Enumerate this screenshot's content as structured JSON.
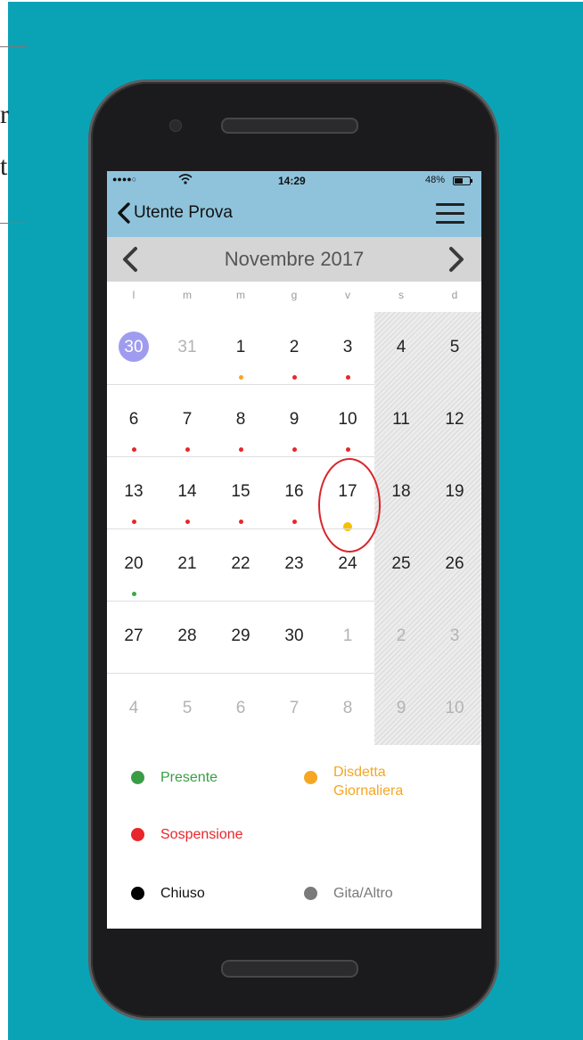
{
  "colors": {
    "background": "#0aa3b5",
    "header_bg": "#8fc3dc",
    "month_bar_bg": "#d5d5d5",
    "today_highlight": "#9f9cf0",
    "annotation_ring": "#d9252b"
  },
  "edge_fragments": [
    "r",
    "t"
  ],
  "status_bar": {
    "signal": "●●●●○",
    "wifi_icon": "wifi-icon",
    "time": "14:29",
    "battery": "48%",
    "battery_icon": "battery-icon"
  },
  "nav": {
    "back_icon": "chevron-left-icon",
    "title": "Utente Prova",
    "menu_icon": "hamburger-menu-icon"
  },
  "calendar": {
    "month_title": "Novembre 2017",
    "prev_icon": "chevron-left-icon",
    "next_icon": "chevron-right-icon",
    "weekdays": [
      "l",
      "m",
      "m",
      "g",
      "v",
      "s",
      "d"
    ],
    "weeks": [
      [
        {
          "day": "30",
          "dim": true,
          "today": true
        },
        {
          "day": "31",
          "dim": true
        },
        {
          "day": "1",
          "dot": "#f5a623"
        },
        {
          "day": "2",
          "dot": "#e8262b"
        },
        {
          "day": "3",
          "dot": "#e8262b"
        },
        {
          "day": "4"
        },
        {
          "day": "5"
        }
      ],
      [
        {
          "day": "6",
          "dot": "#e8262b"
        },
        {
          "day": "7",
          "dot": "#e8262b"
        },
        {
          "day": "8",
          "dot": "#e8262b"
        },
        {
          "day": "9",
          "dot": "#e8262b"
        },
        {
          "day": "10",
          "dot": "#e8262b"
        },
        {
          "day": "11"
        },
        {
          "day": "12"
        }
      ],
      [
        {
          "day": "13",
          "dot": "#e8262b"
        },
        {
          "day": "14",
          "dot": "#e8262b"
        },
        {
          "day": "15",
          "dot": "#e8262b"
        },
        {
          "day": "16",
          "dot": "#e8262b"
        },
        {
          "day": "17",
          "dot": "#f5c000",
          "big": true
        },
        {
          "day": "18"
        },
        {
          "day": "19"
        }
      ],
      [
        {
          "day": "20",
          "dot": "#3aa845"
        },
        {
          "day": "21"
        },
        {
          "day": "22"
        },
        {
          "day": "23"
        },
        {
          "day": "24"
        },
        {
          "day": "25"
        },
        {
          "day": "26"
        }
      ],
      [
        {
          "day": "27"
        },
        {
          "day": "28"
        },
        {
          "day": "29"
        },
        {
          "day": "30"
        },
        {
          "day": "1",
          "dim": true
        },
        {
          "day": "2",
          "dim": true
        },
        {
          "day": "3",
          "dim": true
        }
      ],
      [
        {
          "day": "4",
          "dim": true
        },
        {
          "day": "5",
          "dim": true
        },
        {
          "day": "6",
          "dim": true
        },
        {
          "day": "7",
          "dim": true
        },
        {
          "day": "8",
          "dim": true
        },
        {
          "day": "9",
          "dim": true
        },
        {
          "day": "10",
          "dim": true
        }
      ]
    ]
  },
  "legend": [
    {
      "label": "Presente",
      "dot_color": "#3a9d45",
      "text_color": "#3a9d45"
    },
    {
      "label": "Disdetta\nGiornaliera",
      "dot_color": "#f5a623",
      "text_color": "#f5a623"
    },
    {
      "label": "Sospensione",
      "dot_color": "#e8262b",
      "text_color": "#e8262b"
    },
    {
      "label": "Chiuso",
      "dot_color": "#000000",
      "text_color": "#111111"
    },
    {
      "label": "Gita/Altro",
      "dot_color": "#7a7a7a",
      "text_color": "#7a7a7a"
    }
  ]
}
